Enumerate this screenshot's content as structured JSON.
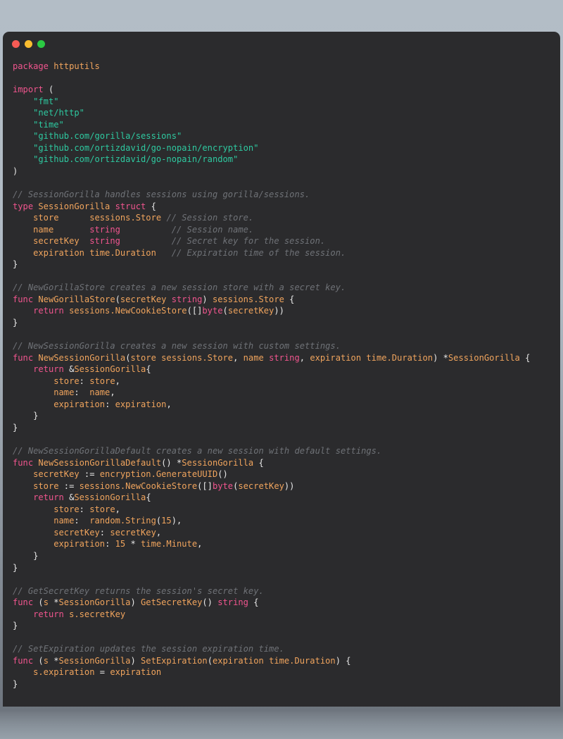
{
  "window": {
    "traffic_lights": [
      {
        "name": "close-button",
        "color": "#f65b55"
      },
      {
        "name": "minimize-button",
        "color": "#f9bd2f"
      },
      {
        "name": "maximize-button",
        "color": "#2bca43"
      }
    ]
  },
  "theme": {
    "background": "#2b2b2d",
    "keyword": "#f0558e",
    "identifier": "#f0a45d",
    "string": "#2ec9a0",
    "comment": "#6f7277",
    "punctuation": "#e8e8e8",
    "desktop_top": "#b3bdc6",
    "desktop_bottom": "#97a1aa"
  },
  "code": {
    "language": "go",
    "package": "httputils",
    "lines": [
      {
        "id": "l1",
        "tokens": [
          {
            "t": "package",
            "c": "kw"
          },
          {
            "t": " ",
            "c": "pun"
          },
          {
            "t": "httputils",
            "c": "id"
          }
        ]
      },
      {
        "id": "l2",
        "tokens": []
      },
      {
        "id": "l3",
        "tokens": [
          {
            "t": "import",
            "c": "kw"
          },
          {
            "t": " (",
            "c": "pun"
          }
        ]
      },
      {
        "id": "l4",
        "tokens": [
          {
            "t": "    ",
            "c": "pun"
          },
          {
            "t": "\"fmt\"",
            "c": "str"
          }
        ]
      },
      {
        "id": "l5",
        "tokens": [
          {
            "t": "    ",
            "c": "pun"
          },
          {
            "t": "\"net/http\"",
            "c": "str"
          }
        ]
      },
      {
        "id": "l6",
        "tokens": [
          {
            "t": "    ",
            "c": "pun"
          },
          {
            "t": "\"time\"",
            "c": "str"
          }
        ]
      },
      {
        "id": "l7",
        "tokens": [
          {
            "t": "    ",
            "c": "pun"
          },
          {
            "t": "\"github.com/gorilla/sessions\"",
            "c": "str"
          }
        ]
      },
      {
        "id": "l8",
        "tokens": [
          {
            "t": "    ",
            "c": "pun"
          },
          {
            "t": "\"github.com/ortizdavid/go-nopain/encryption\"",
            "c": "str"
          }
        ]
      },
      {
        "id": "l9",
        "tokens": [
          {
            "t": "    ",
            "c": "pun"
          },
          {
            "t": "\"github.com/ortizdavid/go-nopain/random\"",
            "c": "str"
          }
        ]
      },
      {
        "id": "l10",
        "tokens": [
          {
            "t": ")",
            "c": "pun"
          }
        ]
      },
      {
        "id": "l11",
        "tokens": []
      },
      {
        "id": "l12",
        "tokens": [
          {
            "t": "// SessionGorilla handles sessions using gorilla/sessions.",
            "c": "cmt"
          }
        ]
      },
      {
        "id": "l13",
        "tokens": [
          {
            "t": "type",
            "c": "kw"
          },
          {
            "t": " ",
            "c": "pun"
          },
          {
            "t": "SessionGorilla",
            "c": "id"
          },
          {
            "t": " ",
            "c": "pun"
          },
          {
            "t": "struct",
            "c": "kw"
          },
          {
            "t": " {",
            "c": "pun"
          }
        ]
      },
      {
        "id": "l14",
        "tokens": [
          {
            "t": "    ",
            "c": "pun"
          },
          {
            "t": "store",
            "c": "id"
          },
          {
            "t": "      ",
            "c": "pun"
          },
          {
            "t": "sessions.Store",
            "c": "id"
          },
          {
            "t": " ",
            "c": "pun"
          },
          {
            "t": "// Session store.",
            "c": "cmt"
          }
        ]
      },
      {
        "id": "l15",
        "tokens": [
          {
            "t": "    ",
            "c": "pun"
          },
          {
            "t": "name",
            "c": "id"
          },
          {
            "t": "       ",
            "c": "pun"
          },
          {
            "t": "string",
            "c": "kw"
          },
          {
            "t": "          ",
            "c": "pun"
          },
          {
            "t": "// Session name.",
            "c": "cmt"
          }
        ]
      },
      {
        "id": "l16",
        "tokens": [
          {
            "t": "    ",
            "c": "pun"
          },
          {
            "t": "secretKey",
            "c": "id"
          },
          {
            "t": "  ",
            "c": "pun"
          },
          {
            "t": "string",
            "c": "kw"
          },
          {
            "t": "          ",
            "c": "pun"
          },
          {
            "t": "// Secret key for the session.",
            "c": "cmt"
          }
        ]
      },
      {
        "id": "l17",
        "tokens": [
          {
            "t": "    ",
            "c": "pun"
          },
          {
            "t": "expiration",
            "c": "id"
          },
          {
            "t": " ",
            "c": "pun"
          },
          {
            "t": "time.Duration",
            "c": "id"
          },
          {
            "t": "   ",
            "c": "pun"
          },
          {
            "t": "// Expiration time of the session.",
            "c": "cmt"
          }
        ]
      },
      {
        "id": "l18",
        "tokens": [
          {
            "t": "}",
            "c": "pun"
          }
        ]
      },
      {
        "id": "l19",
        "tokens": []
      },
      {
        "id": "l20",
        "tokens": [
          {
            "t": "// NewGorillaStore creates a new session store with a secret key.",
            "c": "cmt"
          }
        ]
      },
      {
        "id": "l21",
        "tokens": [
          {
            "t": "func",
            "c": "kw"
          },
          {
            "t": " ",
            "c": "pun"
          },
          {
            "t": "NewGorillaStore",
            "c": "id"
          },
          {
            "t": "(",
            "c": "pun"
          },
          {
            "t": "secretKey",
            "c": "id"
          },
          {
            "t": " ",
            "c": "pun"
          },
          {
            "t": "string",
            "c": "kw"
          },
          {
            "t": ") ",
            "c": "pun"
          },
          {
            "t": "sessions.Store",
            "c": "id"
          },
          {
            "t": " {",
            "c": "pun"
          }
        ]
      },
      {
        "id": "l22",
        "tokens": [
          {
            "t": "    ",
            "c": "pun"
          },
          {
            "t": "return",
            "c": "kw"
          },
          {
            "t": " ",
            "c": "pun"
          },
          {
            "t": "sessions.NewCookieStore",
            "c": "id"
          },
          {
            "t": "([]",
            "c": "pun"
          },
          {
            "t": "byte",
            "c": "kw"
          },
          {
            "t": "(",
            "c": "pun"
          },
          {
            "t": "secretKey",
            "c": "id"
          },
          {
            "t": "))",
            "c": "pun"
          }
        ]
      },
      {
        "id": "l23",
        "tokens": [
          {
            "t": "}",
            "c": "pun"
          }
        ]
      },
      {
        "id": "l24",
        "tokens": []
      },
      {
        "id": "l25",
        "tokens": [
          {
            "t": "// NewSessionGorilla creates a new session with custom settings.",
            "c": "cmt"
          }
        ]
      },
      {
        "id": "l26",
        "tokens": [
          {
            "t": "func",
            "c": "kw"
          },
          {
            "t": " ",
            "c": "pun"
          },
          {
            "t": "NewSessionGorilla",
            "c": "id"
          },
          {
            "t": "(",
            "c": "pun"
          },
          {
            "t": "store",
            "c": "id"
          },
          {
            "t": " ",
            "c": "pun"
          },
          {
            "t": "sessions.Store",
            "c": "id"
          },
          {
            "t": ", ",
            "c": "pun"
          },
          {
            "t": "name",
            "c": "id"
          },
          {
            "t": " ",
            "c": "pun"
          },
          {
            "t": "string",
            "c": "kw"
          },
          {
            "t": ", ",
            "c": "pun"
          },
          {
            "t": "expiration",
            "c": "id"
          },
          {
            "t": " ",
            "c": "pun"
          },
          {
            "t": "time.Duration",
            "c": "id"
          },
          {
            "t": ") *",
            "c": "pun"
          },
          {
            "t": "SessionGorilla",
            "c": "id"
          },
          {
            "t": " {",
            "c": "pun"
          }
        ]
      },
      {
        "id": "l27",
        "tokens": [
          {
            "t": "    ",
            "c": "pun"
          },
          {
            "t": "return",
            "c": "kw"
          },
          {
            "t": " &",
            "c": "pun"
          },
          {
            "t": "SessionGorilla",
            "c": "id"
          },
          {
            "t": "{",
            "c": "pun"
          }
        ]
      },
      {
        "id": "l28",
        "tokens": [
          {
            "t": "        ",
            "c": "pun"
          },
          {
            "t": "store",
            "c": "id"
          },
          {
            "t": ": ",
            "c": "pun"
          },
          {
            "t": "store",
            "c": "id"
          },
          {
            "t": ",",
            "c": "pun"
          }
        ]
      },
      {
        "id": "l29",
        "tokens": [
          {
            "t": "        ",
            "c": "pun"
          },
          {
            "t": "name",
            "c": "id"
          },
          {
            "t": ":  ",
            "c": "pun"
          },
          {
            "t": "name",
            "c": "id"
          },
          {
            "t": ",",
            "c": "pun"
          }
        ]
      },
      {
        "id": "l30",
        "tokens": [
          {
            "t": "        ",
            "c": "pun"
          },
          {
            "t": "expiration",
            "c": "id"
          },
          {
            "t": ": ",
            "c": "pun"
          },
          {
            "t": "expiration",
            "c": "id"
          },
          {
            "t": ",",
            "c": "pun"
          }
        ]
      },
      {
        "id": "l31",
        "tokens": [
          {
            "t": "    }",
            "c": "pun"
          }
        ]
      },
      {
        "id": "l32",
        "tokens": [
          {
            "t": "}",
            "c": "pun"
          }
        ]
      },
      {
        "id": "l33",
        "tokens": []
      },
      {
        "id": "l34",
        "tokens": [
          {
            "t": "// NewSessionGorillaDefault creates a new session with default settings.",
            "c": "cmt"
          }
        ]
      },
      {
        "id": "l35",
        "tokens": [
          {
            "t": "func",
            "c": "kw"
          },
          {
            "t": " ",
            "c": "pun"
          },
          {
            "t": "NewSessionGorillaDefault",
            "c": "id"
          },
          {
            "t": "() *",
            "c": "pun"
          },
          {
            "t": "SessionGorilla",
            "c": "id"
          },
          {
            "t": " {",
            "c": "pun"
          }
        ]
      },
      {
        "id": "l36",
        "tokens": [
          {
            "t": "    ",
            "c": "pun"
          },
          {
            "t": "secretKey",
            "c": "id"
          },
          {
            "t": " := ",
            "c": "pun"
          },
          {
            "t": "encryption.GenerateUUID",
            "c": "id"
          },
          {
            "t": "()",
            "c": "pun"
          }
        ]
      },
      {
        "id": "l37",
        "tokens": [
          {
            "t": "    ",
            "c": "pun"
          },
          {
            "t": "store",
            "c": "id"
          },
          {
            "t": " := ",
            "c": "pun"
          },
          {
            "t": "sessions.NewCookieStore",
            "c": "id"
          },
          {
            "t": "([]",
            "c": "pun"
          },
          {
            "t": "byte",
            "c": "kw"
          },
          {
            "t": "(",
            "c": "pun"
          },
          {
            "t": "secretKey",
            "c": "id"
          },
          {
            "t": "))",
            "c": "pun"
          }
        ]
      },
      {
        "id": "l38",
        "tokens": [
          {
            "t": "    ",
            "c": "pun"
          },
          {
            "t": "return",
            "c": "kw"
          },
          {
            "t": " &",
            "c": "pun"
          },
          {
            "t": "SessionGorilla",
            "c": "id"
          },
          {
            "t": "{",
            "c": "pun"
          }
        ]
      },
      {
        "id": "l39",
        "tokens": [
          {
            "t": "        ",
            "c": "pun"
          },
          {
            "t": "store",
            "c": "id"
          },
          {
            "t": ": ",
            "c": "pun"
          },
          {
            "t": "store",
            "c": "id"
          },
          {
            "t": ",",
            "c": "pun"
          }
        ]
      },
      {
        "id": "l40",
        "tokens": [
          {
            "t": "        ",
            "c": "pun"
          },
          {
            "t": "name",
            "c": "id"
          },
          {
            "t": ":  ",
            "c": "pun"
          },
          {
            "t": "random.String",
            "c": "id"
          },
          {
            "t": "(",
            "c": "pun"
          },
          {
            "t": "15",
            "c": "num"
          },
          {
            "t": "),",
            "c": "pun"
          }
        ]
      },
      {
        "id": "l41",
        "tokens": [
          {
            "t": "        ",
            "c": "pun"
          },
          {
            "t": "secretKey",
            "c": "id"
          },
          {
            "t": ": ",
            "c": "pun"
          },
          {
            "t": "secretKey",
            "c": "id"
          },
          {
            "t": ",",
            "c": "pun"
          }
        ]
      },
      {
        "id": "l42",
        "tokens": [
          {
            "t": "        ",
            "c": "pun"
          },
          {
            "t": "expiration",
            "c": "id"
          },
          {
            "t": ": ",
            "c": "pun"
          },
          {
            "t": "15",
            "c": "num"
          },
          {
            "t": " * ",
            "c": "pun"
          },
          {
            "t": "time.Minute",
            "c": "id"
          },
          {
            "t": ",",
            "c": "pun"
          }
        ]
      },
      {
        "id": "l43",
        "tokens": [
          {
            "t": "    }",
            "c": "pun"
          }
        ]
      },
      {
        "id": "l44",
        "tokens": [
          {
            "t": "}",
            "c": "pun"
          }
        ]
      },
      {
        "id": "l45",
        "tokens": []
      },
      {
        "id": "l46",
        "tokens": [
          {
            "t": "// GetSecretKey returns the session's secret key.",
            "c": "cmt"
          }
        ]
      },
      {
        "id": "l47",
        "tokens": [
          {
            "t": "func",
            "c": "kw"
          },
          {
            "t": " (",
            "c": "pun"
          },
          {
            "t": "s",
            "c": "id"
          },
          {
            "t": " *",
            "c": "pun"
          },
          {
            "t": "SessionGorilla",
            "c": "id"
          },
          {
            "t": ") ",
            "c": "pun"
          },
          {
            "t": "GetSecretKey",
            "c": "id"
          },
          {
            "t": "() ",
            "c": "pun"
          },
          {
            "t": "string",
            "c": "kw"
          },
          {
            "t": " {",
            "c": "pun"
          }
        ]
      },
      {
        "id": "l48",
        "tokens": [
          {
            "t": "    ",
            "c": "pun"
          },
          {
            "t": "return",
            "c": "kw"
          },
          {
            "t": " ",
            "c": "pun"
          },
          {
            "t": "s.secretKey",
            "c": "id"
          }
        ]
      },
      {
        "id": "l49",
        "tokens": [
          {
            "t": "}",
            "c": "pun"
          }
        ]
      },
      {
        "id": "l50",
        "tokens": []
      },
      {
        "id": "l51",
        "tokens": [
          {
            "t": "// SetExpiration updates the session expiration time.",
            "c": "cmt"
          }
        ]
      },
      {
        "id": "l52",
        "tokens": [
          {
            "t": "func",
            "c": "kw"
          },
          {
            "t": " (",
            "c": "pun"
          },
          {
            "t": "s",
            "c": "id"
          },
          {
            "t": " *",
            "c": "pun"
          },
          {
            "t": "SessionGorilla",
            "c": "id"
          },
          {
            "t": ") ",
            "c": "pun"
          },
          {
            "t": "SetExpiration",
            "c": "id"
          },
          {
            "t": "(",
            "c": "pun"
          },
          {
            "t": "expiration",
            "c": "id"
          },
          {
            "t": " ",
            "c": "pun"
          },
          {
            "t": "time.Duration",
            "c": "id"
          },
          {
            "t": ") {",
            "c": "pun"
          }
        ]
      },
      {
        "id": "l53",
        "tokens": [
          {
            "t": "    ",
            "c": "pun"
          },
          {
            "t": "s.expiration",
            "c": "id"
          },
          {
            "t": " = ",
            "c": "pun"
          },
          {
            "t": "expiration",
            "c": "id"
          }
        ]
      },
      {
        "id": "l54",
        "tokens": [
          {
            "t": "}",
            "c": "pun"
          }
        ]
      }
    ]
  }
}
